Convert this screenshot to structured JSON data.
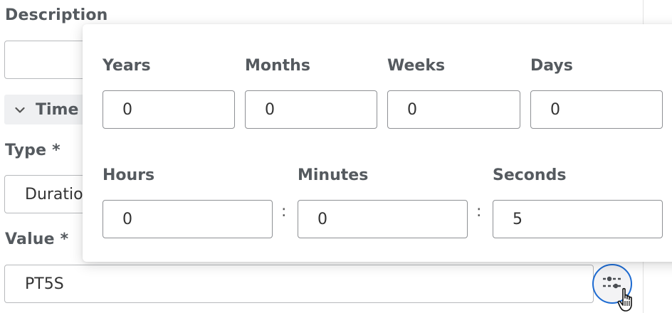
{
  "form": {
    "description_label": "Description",
    "description_value": "",
    "group_title": "Time",
    "type_label": "Type *",
    "type_value": "Duration",
    "value_label": "Value *",
    "value_value": "PT5S"
  },
  "picker": {
    "years": {
      "label": "Years",
      "value": "0"
    },
    "months": {
      "label": "Months",
      "value": "0"
    },
    "weeks": {
      "label": "Weeks",
      "value": "0"
    },
    "days": {
      "label": "Days",
      "value": "0"
    },
    "hours": {
      "label": "Hours",
      "value": "0"
    },
    "minutes": {
      "label": "Minutes",
      "value": "0"
    },
    "seconds": {
      "label": "Seconds",
      "value": "5"
    },
    "separator": ":"
  },
  "icons": {
    "group_toggle": "chevron-down-icon",
    "picker_button": "sliders-icon",
    "cursor": "hand-pointer-icon"
  },
  "colors": {
    "focus_ring": "#1d6bd2",
    "label": "#555a5f"
  }
}
